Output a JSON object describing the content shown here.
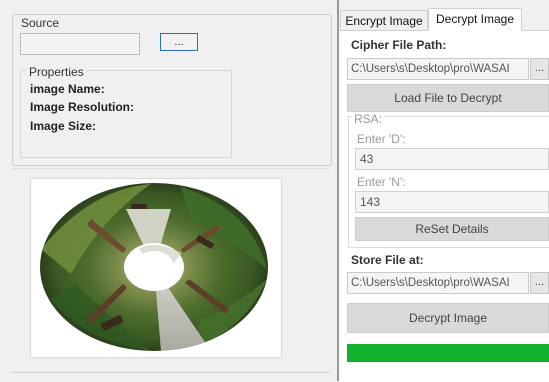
{
  "left": {
    "source_label": "Source",
    "source_path_value": "",
    "browse_label": "...",
    "properties_label": "Properties",
    "image_name_label": "image  Name:",
    "image_resolution_label": "Image Resolution:",
    "image_size_label": "Image Size:"
  },
  "tabs": [
    {
      "label": "Encrypt Image"
    },
    {
      "label": "Decrypt Image"
    }
  ],
  "decrypt": {
    "cipher_path_label": "Cipher File Path:",
    "cipher_path_value": "C:\\Users\\s\\Desktop\\pro\\WASAI",
    "cipher_browse_label": "...",
    "load_button_label": "Load File to Decrypt",
    "rsa_label": "RSA:",
    "enter_d_label": "Enter 'D':",
    "d_value": "43",
    "enter_n_label": "Enter 'N':",
    "n_value": "143",
    "reset_button_label": "ReSet Details",
    "store_label": "Store File at:",
    "store_path_value": "C:\\Users\\s\\Desktop\\pro\\WASAI",
    "store_browse_label": "...",
    "decrypt_button_label": "Decrypt Image",
    "progress": 1.0
  },
  "colors": {
    "progress_green": "#12b02c",
    "browse_border": "#2f6fb7"
  }
}
